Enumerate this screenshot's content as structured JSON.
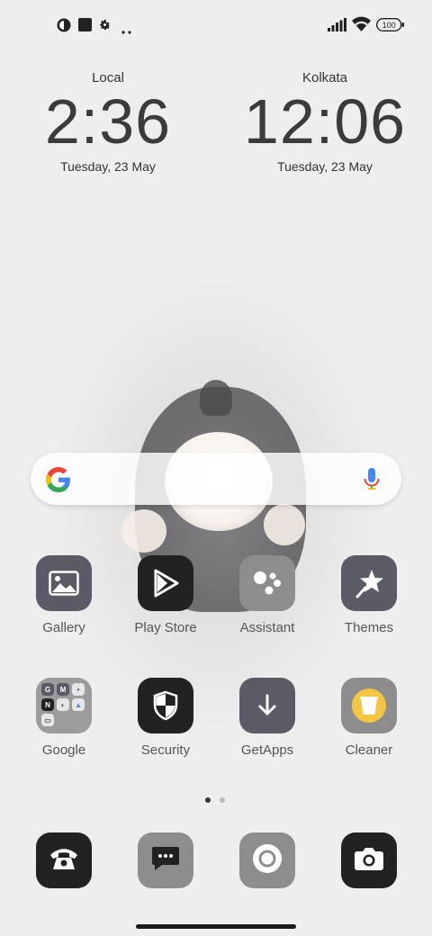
{
  "status_bar": {
    "battery_level": "100",
    "left_icons": [
      "notification-icon",
      "square-icon",
      "gear-icon",
      "more-dots-icon"
    ],
    "right_icons": [
      "signal-icon",
      "wifi-icon",
      "battery-icon"
    ]
  },
  "clocks": [
    {
      "city": "Local",
      "time": "2:36",
      "date": "Tuesday, 23 May"
    },
    {
      "city": "Kolkata",
      "time": "12:06",
      "date": "Tuesday, 23 May"
    }
  ],
  "search_bar": {
    "icons": [
      "google-g-icon",
      "microphone-icon"
    ]
  },
  "apps_row1": [
    {
      "label": "Gallery",
      "icon": "gallery-icon",
      "bg": "#5a5b66"
    },
    {
      "label": "Play Store",
      "icon": "play-store-icon",
      "bg": "#222222"
    },
    {
      "label": "Assistant",
      "icon": "assistant-icon",
      "bg": "#8d8d8f"
    },
    {
      "label": "Themes",
      "icon": "themes-icon",
      "bg": "#5a5b66"
    }
  ],
  "apps_row2": [
    {
      "label": "Google",
      "icon": "google-folder-icon",
      "bg": "#9c9c9c"
    },
    {
      "label": "Security",
      "icon": "security-icon",
      "bg": "#222222"
    },
    {
      "label": "GetApps",
      "icon": "getapps-icon",
      "bg": "#5a5b66"
    },
    {
      "label": "Cleaner",
      "icon": "cleaner-icon",
      "bg": "#8d8d8f"
    }
  ],
  "page_indicator": {
    "pages": 2,
    "active": 1
  },
  "dock": [
    {
      "icon": "phone-icon",
      "bg": "#222222"
    },
    {
      "icon": "messages-icon",
      "bg": "#8d8d8f"
    },
    {
      "icon": "browser-icon",
      "bg": "#8d8d8f"
    },
    {
      "icon": "camera-icon",
      "bg": "#222222"
    }
  ],
  "colors": {
    "text": "#3b3b3b",
    "label": "#555555",
    "background": "#eeeeee"
  }
}
